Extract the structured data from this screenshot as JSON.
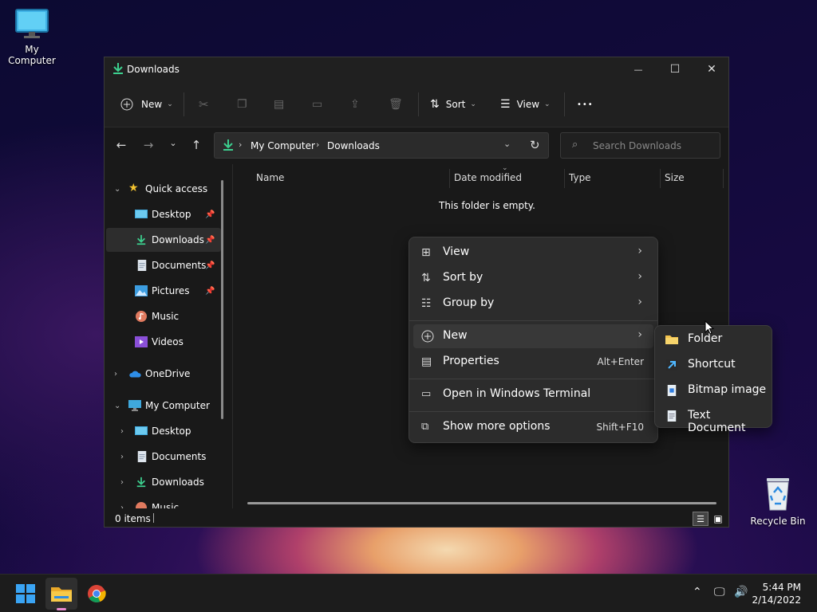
{
  "desktop": {
    "my_computer_label": "My Computer",
    "recycle_bin_label": "Recycle Bin"
  },
  "window": {
    "title": "Downloads",
    "controls": {
      "minimize": "—",
      "maximize": "☐",
      "close": "✕"
    }
  },
  "toolbar": {
    "new_label": "New",
    "sort_label": "Sort",
    "view_label": "View",
    "more_label": "•••"
  },
  "address": {
    "segments": [
      "My Computer",
      "Downloads"
    ],
    "search_placeholder": "Search Downloads"
  },
  "nav_pane": {
    "quick_access": "Quick access",
    "quick_items": [
      "Desktop",
      "Downloads",
      "Documents",
      "Pictures",
      "Music",
      "Videos"
    ],
    "onedrive": "OneDrive",
    "my_computer": "My Computer",
    "computer_items": [
      "Desktop",
      "Documents",
      "Downloads",
      "Music"
    ]
  },
  "content": {
    "columns": [
      "Name",
      "Date modified",
      "Type",
      "Size"
    ],
    "empty_message": "This folder is empty."
  },
  "status": {
    "items": "0 items"
  },
  "context_menu": {
    "items": [
      {
        "label": "View",
        "icon": "grid-icon",
        "submenu": true
      },
      {
        "label": "Sort by",
        "icon": "sort-icon",
        "submenu": true
      },
      {
        "label": "Group by",
        "icon": "list-icon",
        "submenu": true
      },
      {
        "label": "New",
        "icon": "plus-circle-icon",
        "submenu": true
      },
      {
        "label": "Properties",
        "icon": "properties-icon",
        "shortcut": "Alt+Enter"
      },
      {
        "label": "Open in Windows Terminal",
        "icon": "terminal-icon"
      },
      {
        "label": "Show more options",
        "icon": "more-options-icon",
        "shortcut": "Shift+F10"
      }
    ]
  },
  "new_submenu": {
    "items": [
      "Folder",
      "Shortcut",
      "Bitmap image",
      "Text Document"
    ]
  },
  "taskbar": {
    "time": "5:44 PM",
    "date": "2/14/2022"
  },
  "colors": {
    "accent_green": "#3ccf8e",
    "folder_yellow": "#f2c24d",
    "selection": "#2d2d2d",
    "menu_bg": "#2c2c2c"
  }
}
